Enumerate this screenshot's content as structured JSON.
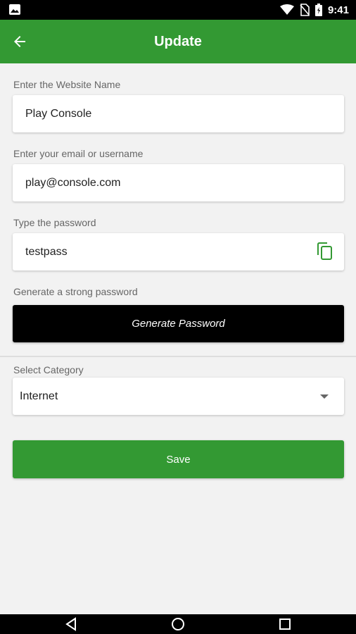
{
  "status_bar": {
    "time": "9:41"
  },
  "app_bar": {
    "title": "Update"
  },
  "form": {
    "website": {
      "label": "Enter the Website Name",
      "value": "Play Console"
    },
    "email": {
      "label": "Enter your email or username",
      "value": "play@console.com"
    },
    "password": {
      "label": "Type the password",
      "value": "testpass"
    },
    "generate": {
      "label": "Generate a strong password",
      "button": "Generate Password"
    },
    "category": {
      "label": "Select Category",
      "value": "Internet"
    },
    "save_button": "Save"
  },
  "colors": {
    "primary": "#339933",
    "generate_button": "#000000",
    "background": "#f2f2f2"
  },
  "icons": {
    "status_left": "gallery-icon",
    "status_right": [
      "wifi-icon",
      "no-sim-icon",
      "battery-icon"
    ],
    "app_bar": "back-arrow-icon",
    "password": "copy-icon",
    "nav": [
      "back-triangle-icon",
      "home-circle-icon",
      "recents-square-icon"
    ]
  }
}
